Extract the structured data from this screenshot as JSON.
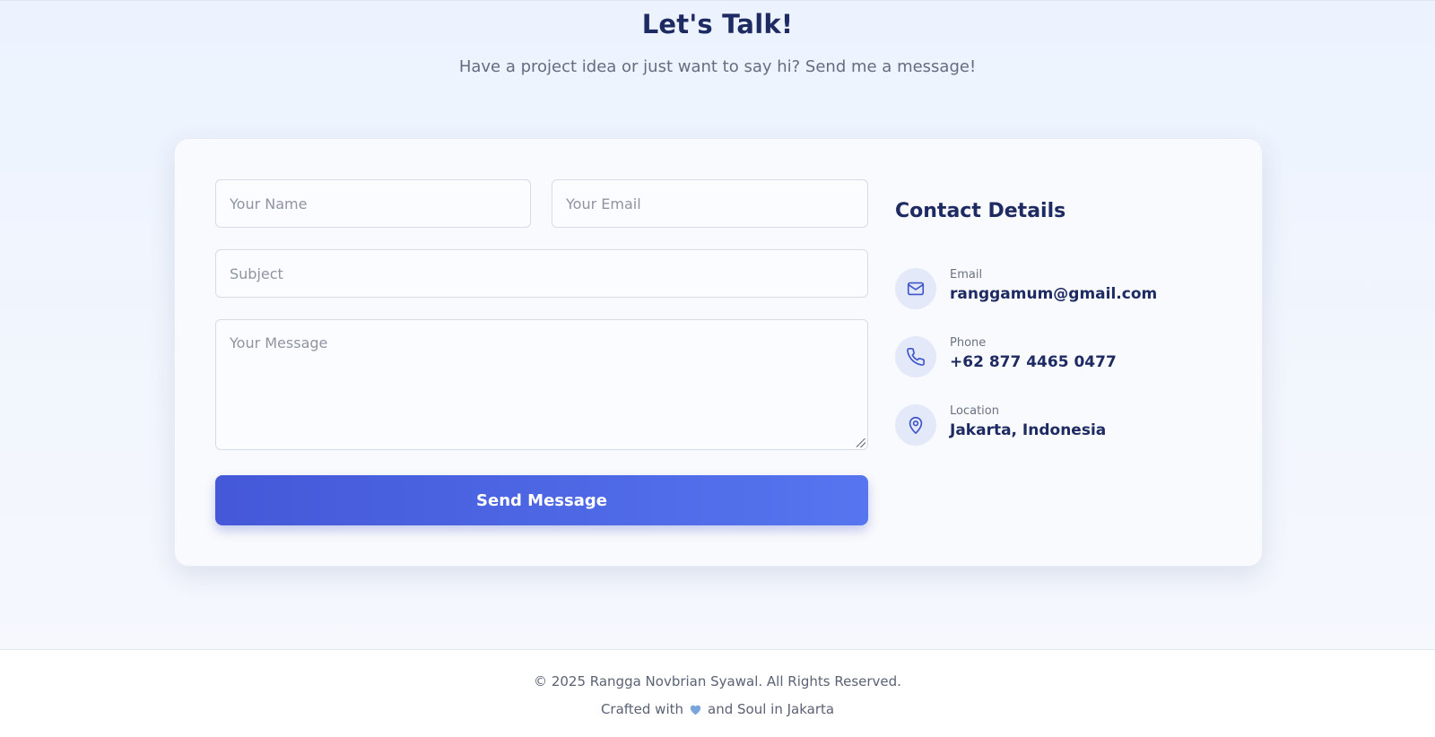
{
  "header": {
    "title": "Let's Talk!",
    "subtitle": "Have a project idea or just want to say hi? Send me a message!"
  },
  "form": {
    "name_placeholder": "Your Name",
    "email_placeholder": "Your Email",
    "subject_placeholder": "Subject",
    "message_placeholder": "Your Message",
    "submit_label": "Send Message"
  },
  "contact": {
    "title": "Contact Details",
    "items": [
      {
        "label": "Email",
        "value": "ranggamum@gmail.com",
        "icon": "mail-icon"
      },
      {
        "label": "Phone",
        "value": "+62 877 4465 0477",
        "icon": "phone-icon"
      },
      {
        "label": "Location",
        "value": "Jakarta, Indonesia",
        "icon": "location-pin-icon"
      }
    ]
  },
  "footer": {
    "copyright": "© 2025 Rangga Novbrian Syawal. All Rights Reserved.",
    "crafted_prefix": "Crafted with",
    "crafted_suffix": "and Soul in Jakarta"
  },
  "colors": {
    "accent_start": "#4458d8",
    "accent_end": "#5675ef",
    "heading": "#1e2a62",
    "heart": "#7aa5dc"
  }
}
